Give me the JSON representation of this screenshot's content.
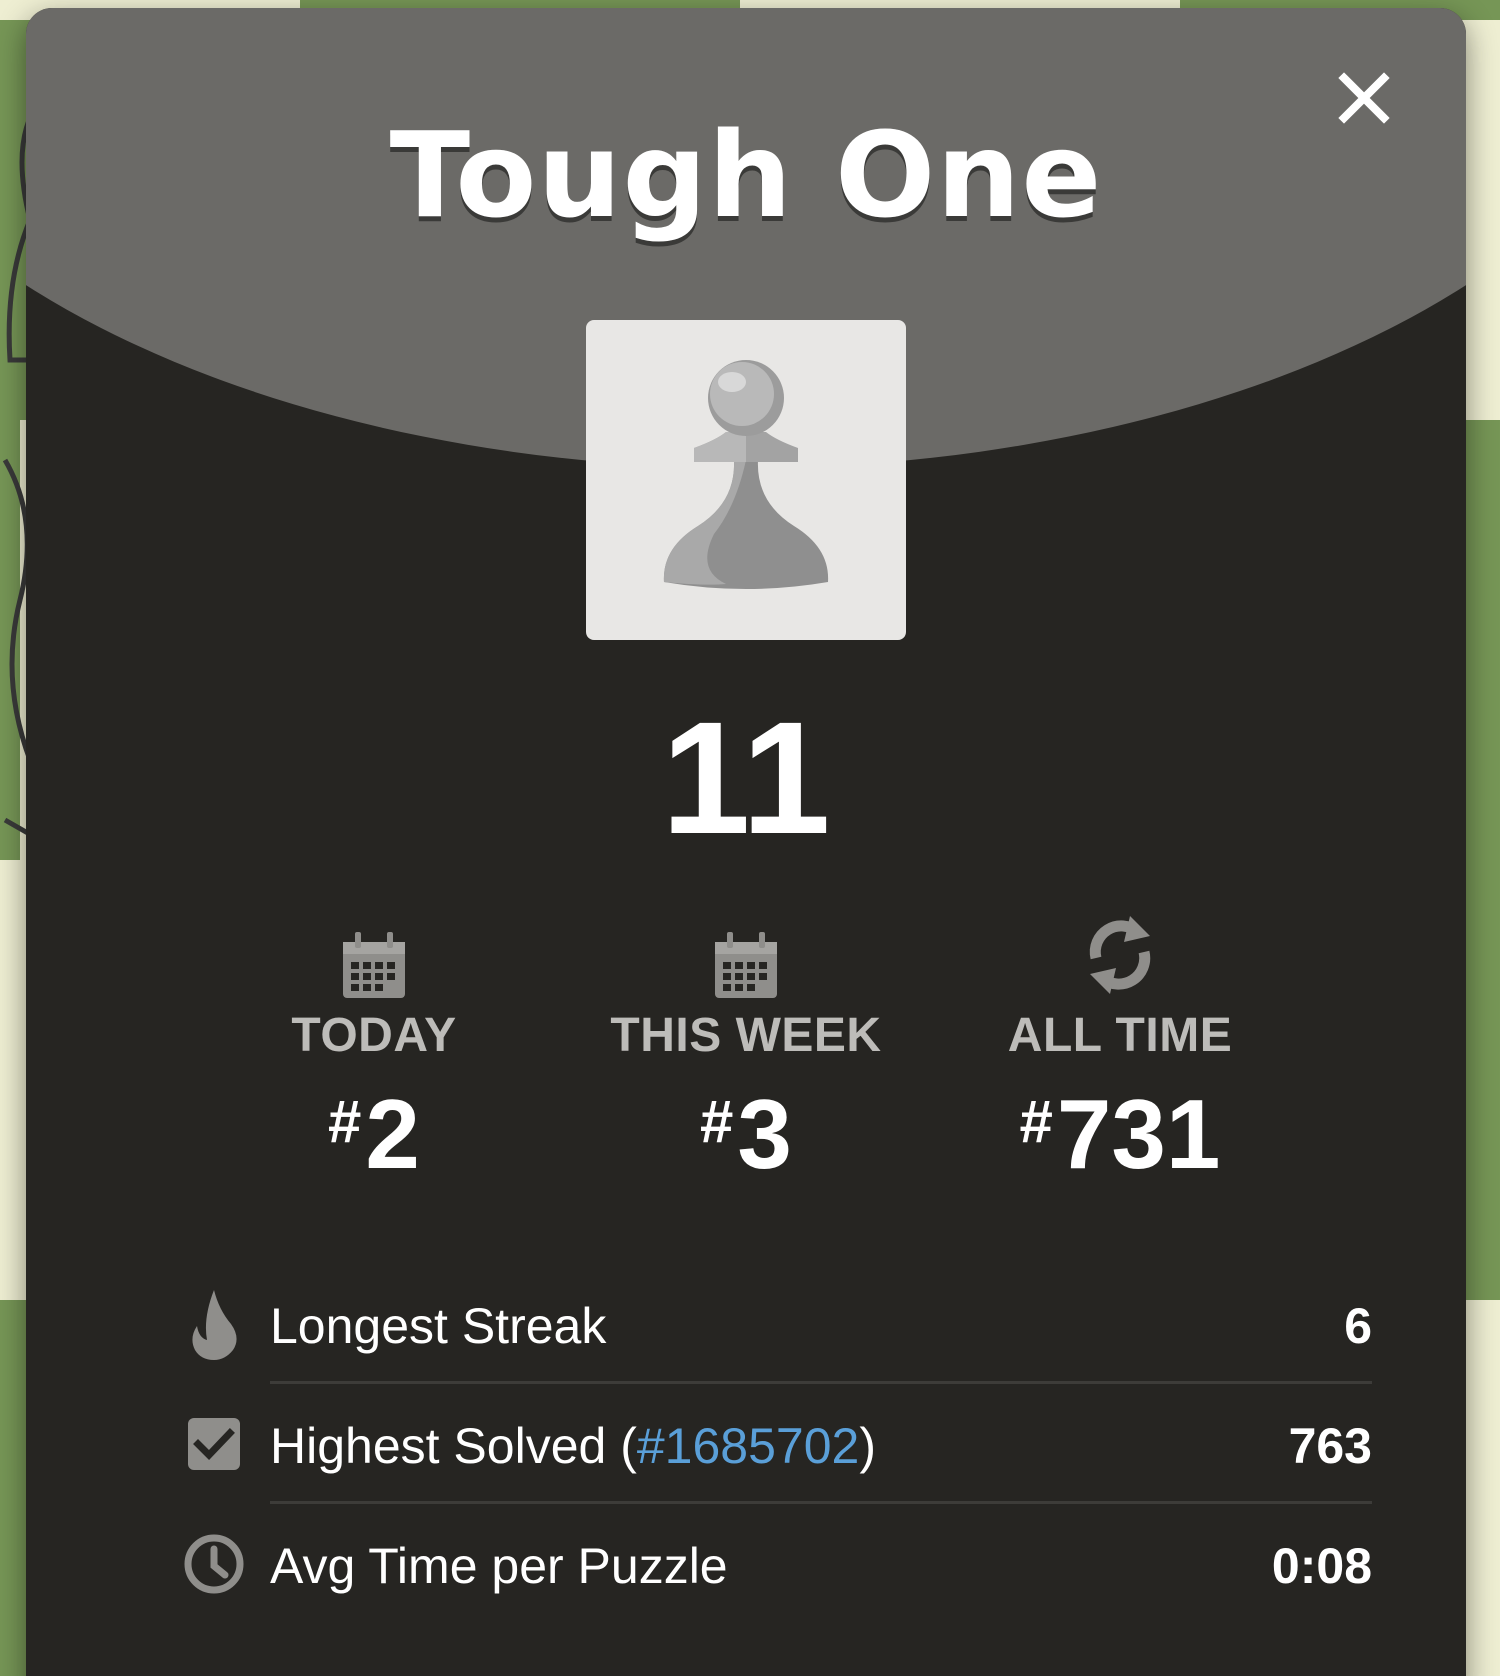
{
  "modal": {
    "title": "Tough One",
    "score": "11",
    "close_icon": "close-icon",
    "badge_icon": "pawn-icon"
  },
  "ranks": [
    {
      "icon": "calendar-icon",
      "label": "TODAY",
      "hash": "#",
      "value": "2"
    },
    {
      "icon": "calendar-icon",
      "label": "THIS WEEK",
      "hash": "#",
      "value": "3"
    },
    {
      "icon": "refresh-icon",
      "label": "ALL TIME",
      "hash": "#",
      "value": "731"
    }
  ],
  "stats": {
    "longest_streak": {
      "icon": "flame-icon",
      "label": "Longest Streak",
      "value": "6"
    },
    "highest_solved": {
      "icon": "checkbox-icon",
      "label_prefix": "Highest Solved (",
      "link": "#1685702",
      "label_suffix": ")",
      "value": "763"
    },
    "avg_time": {
      "icon": "clock-icon",
      "label": "Avg Time per Puzzle",
      "value": "0:08"
    }
  },
  "colors": {
    "modal_bg": "#262522",
    "header_bg": "#6b6a67",
    "link": "#5a9fd8",
    "board_dark": "#769656",
    "board_light": "#eeeed2"
  }
}
